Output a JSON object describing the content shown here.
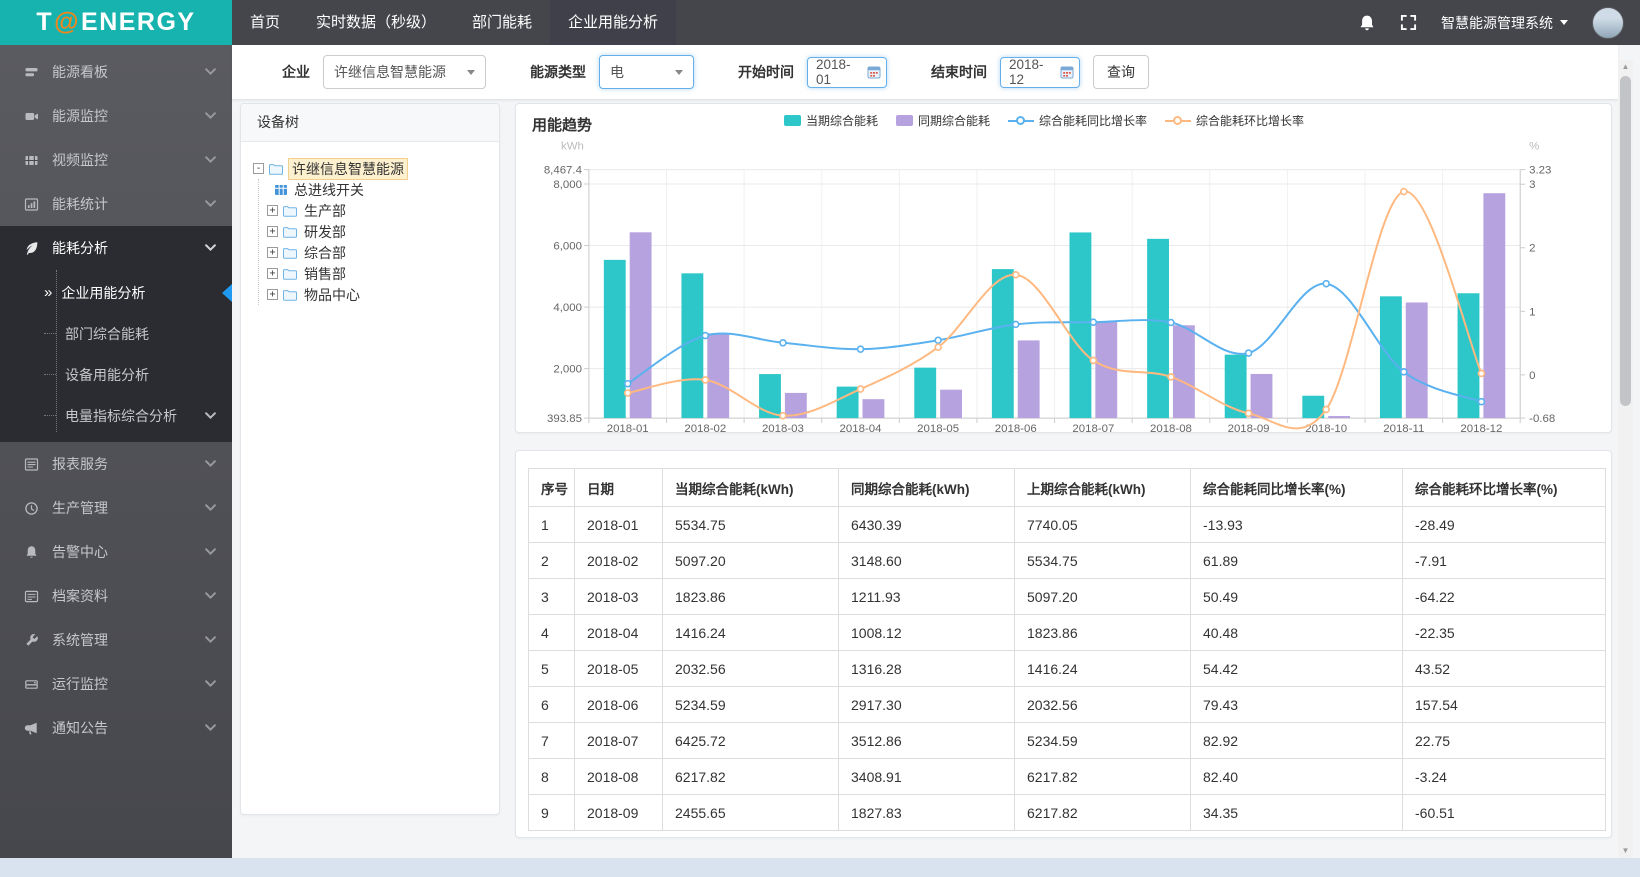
{
  "logo": {
    "prefix": "T",
    "at": "@",
    "suffix": "ENERGY"
  },
  "header": {
    "system_name": "智慧能源管理系统",
    "nav": [
      {
        "label": "首页",
        "active": false
      },
      {
        "label": "实时数据（秒级）",
        "active": false
      },
      {
        "label": "部门能耗",
        "active": false
      },
      {
        "label": "企业用能分析",
        "active": true
      }
    ]
  },
  "sidebar": {
    "items": [
      {
        "label": "能源看板",
        "icon": "board-icon"
      },
      {
        "label": "能源监控",
        "icon": "camera-icon"
      },
      {
        "label": "视频监控",
        "icon": "film-icon"
      },
      {
        "label": "能耗统计",
        "icon": "chart-icon"
      },
      {
        "label": "能耗分析",
        "icon": "leaf-icon",
        "expanded": true,
        "children": [
          {
            "label": "企业用能分析",
            "active": true
          },
          {
            "label": "部门综合能耗"
          },
          {
            "label": "设备用能分析"
          },
          {
            "label": "电量指标综合分析",
            "has_children": true
          }
        ]
      },
      {
        "label": "报表服务",
        "icon": "report-icon"
      },
      {
        "label": "生产管理",
        "icon": "clock-icon"
      },
      {
        "label": "告警中心",
        "icon": "bell-icon"
      },
      {
        "label": "档案资料",
        "icon": "archive-icon"
      },
      {
        "label": "系统管理",
        "icon": "wrench-icon"
      },
      {
        "label": "运行监控",
        "icon": "hdd-icon"
      },
      {
        "label": "通知公告",
        "icon": "megaphone-icon"
      }
    ]
  },
  "filters": {
    "company_label": "企业",
    "company_value": "许继信息智慧能源",
    "energy_type_label": "能源类型",
    "energy_type_value": "电",
    "start_label": "开始时间",
    "start_value": "2018-01",
    "end_label": "结束时间",
    "end_value": "2018-12",
    "search_label": "查询"
  },
  "tree": {
    "title": "设备树",
    "root": {
      "label": "许继信息智慧能源",
      "selected": true,
      "expanded": true
    },
    "children": [
      {
        "label": "总进线开关",
        "type": "meter"
      },
      {
        "label": "生产部",
        "type": "folder",
        "collapsed": true
      },
      {
        "label": "研发部",
        "type": "folder",
        "collapsed": true
      },
      {
        "label": "综合部",
        "type": "folder",
        "collapsed": true
      },
      {
        "label": "销售部",
        "type": "folder",
        "collapsed": true
      },
      {
        "label": "物品中心",
        "type": "folder",
        "collapsed": true
      }
    ]
  },
  "chart": {
    "title": "用能趋势"
  },
  "chart_data": {
    "type": "bar+line combo",
    "categories": [
      "2018-01",
      "2018-02",
      "2018-03",
      "2018-04",
      "2018-05",
      "2018-06",
      "2018-07",
      "2018-08",
      "2018-09",
      "2018-10",
      "2018-11",
      "2018-12"
    ],
    "series": [
      {
        "name": "当期综合能耗",
        "type": "bar",
        "axis": "left",
        "color": "#2ec7c9",
        "values": [
          5534.75,
          5097.2,
          1823.86,
          1416.24,
          2032.56,
          5234.59,
          6425.72,
          6217.82,
          2455.65,
          1120,
          4350,
          4450
        ]
      },
      {
        "name": "同期综合能耗",
        "type": "bar",
        "axis": "left",
        "color": "#b6a2de",
        "values": [
          6430.39,
          3148.6,
          1211.93,
          1008.12,
          1316.28,
          2917.3,
          3512.86,
          3408.91,
          1827.83,
          460,
          4150,
          7700
        ]
      },
      {
        "name": "综合能耗同比增长率",
        "type": "line",
        "axis": "right",
        "unit": "%",
        "color": "#5ab1ef",
        "values": [
          -13.93,
          61.89,
          50.49,
          40.48,
          54.42,
          79.43,
          82.92,
          82.4,
          34.35,
          143.5,
          4.8,
          -42.2
        ]
      },
      {
        "name": "综合能耗环比增长率",
        "type": "line",
        "axis": "right",
        "unit": "%",
        "color": "#ffb980",
        "values": [
          -28.49,
          -7.91,
          -64.22,
          -22.35,
          43.52,
          157.54,
          22.75,
          -3.24,
          -60.51,
          -54.4,
          288.4,
          2.3
        ]
      }
    ],
    "y_left": {
      "unit": "kWh",
      "min": 393.85,
      "max": 8467.4,
      "ticks": [
        393.85,
        2000,
        4000,
        6000,
        8000,
        8467.4
      ],
      "tick_labels": [
        "393.85",
        "2,000",
        "4,000",
        "6,000",
        "8,000",
        "8,467.4"
      ]
    },
    "y_right": {
      "unit": "%",
      "min": -0.68,
      "max": 3.23,
      "ticks": [
        -0.68,
        0,
        1,
        2,
        3,
        3.23
      ],
      "tick_labels": [
        "-0.68",
        "0",
        "1",
        "2",
        "3",
        "3.23"
      ]
    },
    "legend_position": "top",
    "grid": true,
    "note": "line series plotted as rate/100 on right axis; months 2018-10..12 estimated from chart pixels"
  },
  "table": {
    "headers": [
      "序号",
      "日期",
      "当期综合能耗(kWh)",
      "同期综合能耗(kWh)",
      "上期综合能耗(kWh)",
      "综合能耗同比增长率(%)",
      "综合能耗环比增长率(%)"
    ],
    "rows": [
      [
        "1",
        "2018-01",
        "5534.75",
        "6430.39",
        "7740.05",
        "-13.93",
        "-28.49"
      ],
      [
        "2",
        "2018-02",
        "5097.20",
        "3148.60",
        "5534.75",
        "61.89",
        "-7.91"
      ],
      [
        "3",
        "2018-03",
        "1823.86",
        "1211.93",
        "5097.20",
        "50.49",
        "-64.22"
      ],
      [
        "4",
        "2018-04",
        "1416.24",
        "1008.12",
        "1823.86",
        "40.48",
        "-22.35"
      ],
      [
        "5",
        "2018-05",
        "2032.56",
        "1316.28",
        "1416.24",
        "54.42",
        "43.52"
      ],
      [
        "6",
        "2018-06",
        "5234.59",
        "2917.30",
        "2032.56",
        "79.43",
        "157.54"
      ],
      [
        "7",
        "2018-07",
        "6425.72",
        "3512.86",
        "5234.59",
        "82.92",
        "22.75"
      ],
      [
        "8",
        "2018-08",
        "6217.82",
        "3408.91",
        "6217.82",
        "82.40",
        "-3.24"
      ],
      [
        "9",
        "2018-09",
        "2455.65",
        "1827.83",
        "6217.82",
        "34.35",
        "-60.51"
      ]
    ]
  },
  "colors": {
    "brand_teal": "#17b3ae",
    "brand_orange": "#f0861d",
    "topbar": "#45464c",
    "sidebar_dark": "#2b2c31",
    "active_indicator_blue": "#1f9af0",
    "focus_border_blue": "#66afe9",
    "tree_selected_bg": "#fdf0ce"
  }
}
